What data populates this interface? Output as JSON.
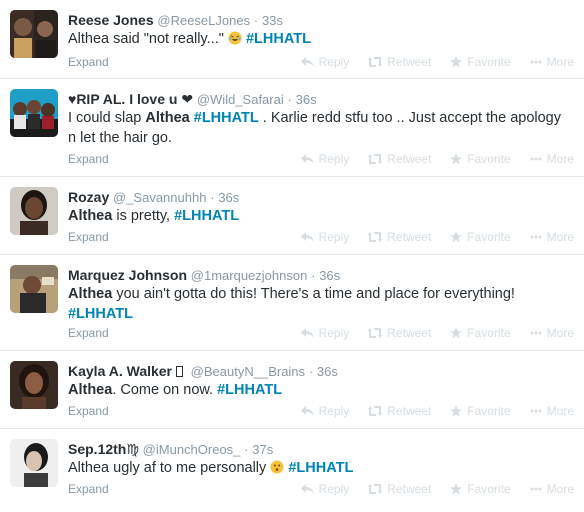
{
  "colors": {
    "link": "#0084b4",
    "muted": "#8899a6",
    "action": "#d7dde1"
  },
  "actions": {
    "reply": "Reply",
    "retweet": "Retweet",
    "favorite": "Favorite",
    "more": "More",
    "expand": "Expand"
  },
  "tweets": [
    {
      "fullname": "Reese Jones",
      "username": "@ReeseLJones",
      "sep": "·",
      "time": "33s",
      "parts": [
        "Althea said \"not really...\" ",
        "#LHHATL"
      ],
      "emoji": "laughing-emoji"
    },
    {
      "fullname": "♥RIP AL. I love u ❤",
      "username": "@Wild_Safarai",
      "sep": "·",
      "time": "36s",
      "parts": [
        "I could slap ",
        "Althea",
        " ",
        "#LHHATL",
        " . Karlie redd stfu too .. Just accept the apology n let the hair go."
      ]
    },
    {
      "fullname": "Rozay",
      "username": "@_Savannuhhh",
      "sep": "·",
      "time": "36s",
      "parts": [
        "Althea",
        " is pretty, ",
        "#LHHATL"
      ]
    },
    {
      "fullname": "Marquez Johnson",
      "username": "@1marquezjohnson",
      "sep": "·",
      "time": "36s",
      "parts": [
        "Althea",
        " you ain't gotta do this! There's a time and place for everything! ",
        "#LHHATL"
      ]
    },
    {
      "fullname": "Kayla A. Walker ",
      "username": "@BeautyN__Brains",
      "sep": "·",
      "time": "36s",
      "parts": [
        "Althea",
        ". Come on now. ",
        "#LHHATL"
      ]
    },
    {
      "fullname": "Sep.12th♍",
      "username": "@iMunchOreos_",
      "sep": "·",
      "time": "37s",
      "parts": [
        "Althea ugly af to me personally ",
        " ",
        "#LHHATL"
      ],
      "emoji": "neutral-face-emoji"
    }
  ]
}
